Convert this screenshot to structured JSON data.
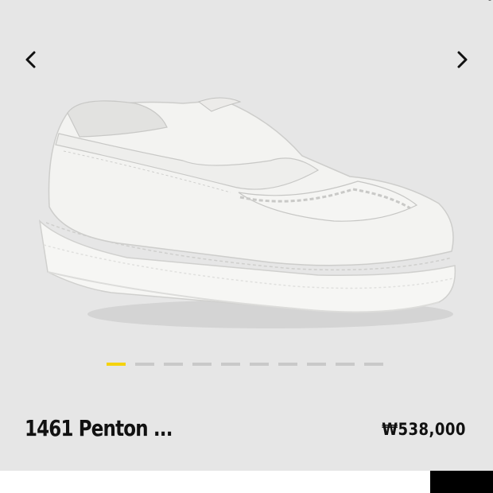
{
  "product": {
    "name": "1461 Penton ...",
    "price": "₩538,000"
  },
  "carousel": {
    "slide_count": 10,
    "active_index": 0,
    "indicator_color_active": "#f5d30e",
    "indicator_color_inactive": "#c9c9c9"
  },
  "colors": {
    "card_background": "#e6e6e6",
    "text": "#111111"
  },
  "icons": {
    "prev": "chevron-left-icon",
    "next": "chevron-right-icon"
  }
}
